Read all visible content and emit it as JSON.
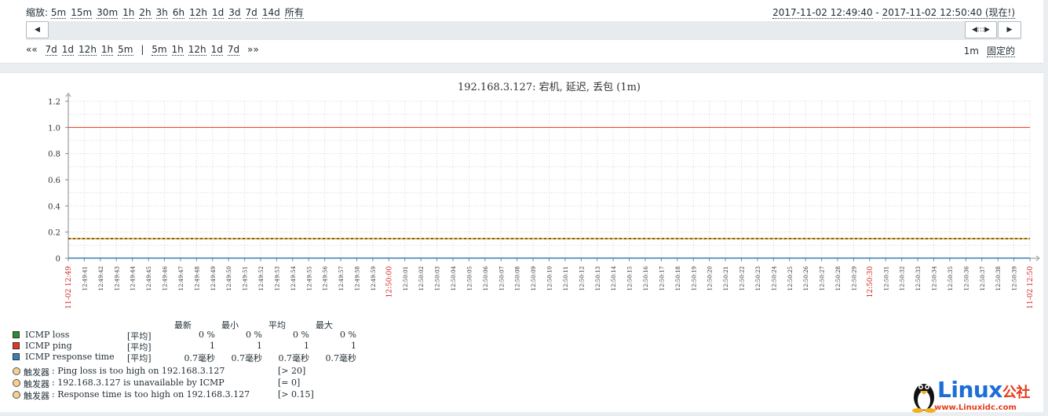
{
  "zoom": {
    "label": "缩放:",
    "options": [
      "5m",
      "15m",
      "30m",
      "1h",
      "2h",
      "3h",
      "6h",
      "12h",
      "1d",
      "3d",
      "7d",
      "14d",
      "所有"
    ]
  },
  "period": {
    "from": "2017-11-02 12:49:40",
    "sep": " - ",
    "to": "2017-11-02 12:50:40 (现在!)"
  },
  "scroller": {
    "left_arrow": "◀",
    "handle": "◀:::▶",
    "right_arrow": "▶"
  },
  "nav": {
    "back_marker": "««",
    "back": [
      "7d",
      "1d",
      "12h",
      "1h",
      "5m"
    ],
    "divider": "|",
    "forward": [
      "5m",
      "1h",
      "12h",
      "1d",
      "7d"
    ],
    "forward_marker": "»»"
  },
  "fixed": {
    "step": "1m",
    "fixed_label": "固定的"
  },
  "graph": {
    "title": "192.168.3.127: 宕机, 延迟, 丢包 (1m)",
    "colors": {
      "loss": "#2a8f2a",
      "ping": "#e8361b",
      "response": "#3a7fb6",
      "trigger": "#d4a017",
      "grid": "#d8d8d8",
      "red_label": "#d02020"
    }
  },
  "chart_data": {
    "type": "line",
    "title": "192.168.3.127: 宕机, 延迟, 丢包 (1m)",
    "ylim": [
      0,
      1.2
    ],
    "yticks": [
      "0",
      "0.2",
      "0.4",
      "0.6",
      "0.8",
      "1.0",
      "1.2"
    ],
    "x_start_label": "11-02 12:49",
    "x_mid_label": "12:50:00",
    "x_mid2_label": "12:50:30",
    "x_end_label": "11-02 12:50",
    "series": [
      {
        "name": "ICMP loss",
        "values": [
          0,
          0
        ]
      },
      {
        "name": "ICMP ping",
        "values": [
          1,
          1
        ]
      },
      {
        "name": "ICMP response time",
        "values": [
          0.0007,
          0.0007
        ]
      }
    ],
    "trigger_line": 0.15,
    "grid": true
  },
  "legend": {
    "headers": [
      "最新",
      "最小",
      "平均",
      "最大"
    ],
    "items": [
      {
        "name": "ICMP loss",
        "func": "[平均]",
        "last": "0 %",
        "min": "0 %",
        "avg": "0 %",
        "max": "0 %",
        "color": "#2a8f2a"
      },
      {
        "name": "ICMP ping",
        "func": "[平均]",
        "last": "1",
        "min": "1",
        "avg": "1",
        "max": "1",
        "color": "#e8361b"
      },
      {
        "name": "ICMP response time",
        "func": "[平均]",
        "last": "0.7毫秒",
        "min": "0.7毫秒",
        "avg": "0.7毫秒",
        "max": "0.7毫秒",
        "color": "#3a7fb6"
      }
    ],
    "triggers": [
      {
        "prefix": "触发器",
        "text": ": Ping loss is too high on 192.168.3.127",
        "cond": "[> 20]"
      },
      {
        "prefix": "触发器",
        "text": ": 192.168.3.127 is unavailable by ICMP",
        "cond": "[= 0]"
      },
      {
        "prefix": "触发器",
        "text": ": Response time is too high on 192.168.3.127",
        "cond": "[> 0.15]"
      }
    ]
  },
  "watermark": {
    "brand": "Linux",
    "brand2": "公社",
    "url": "www.Linuxidc.com"
  }
}
